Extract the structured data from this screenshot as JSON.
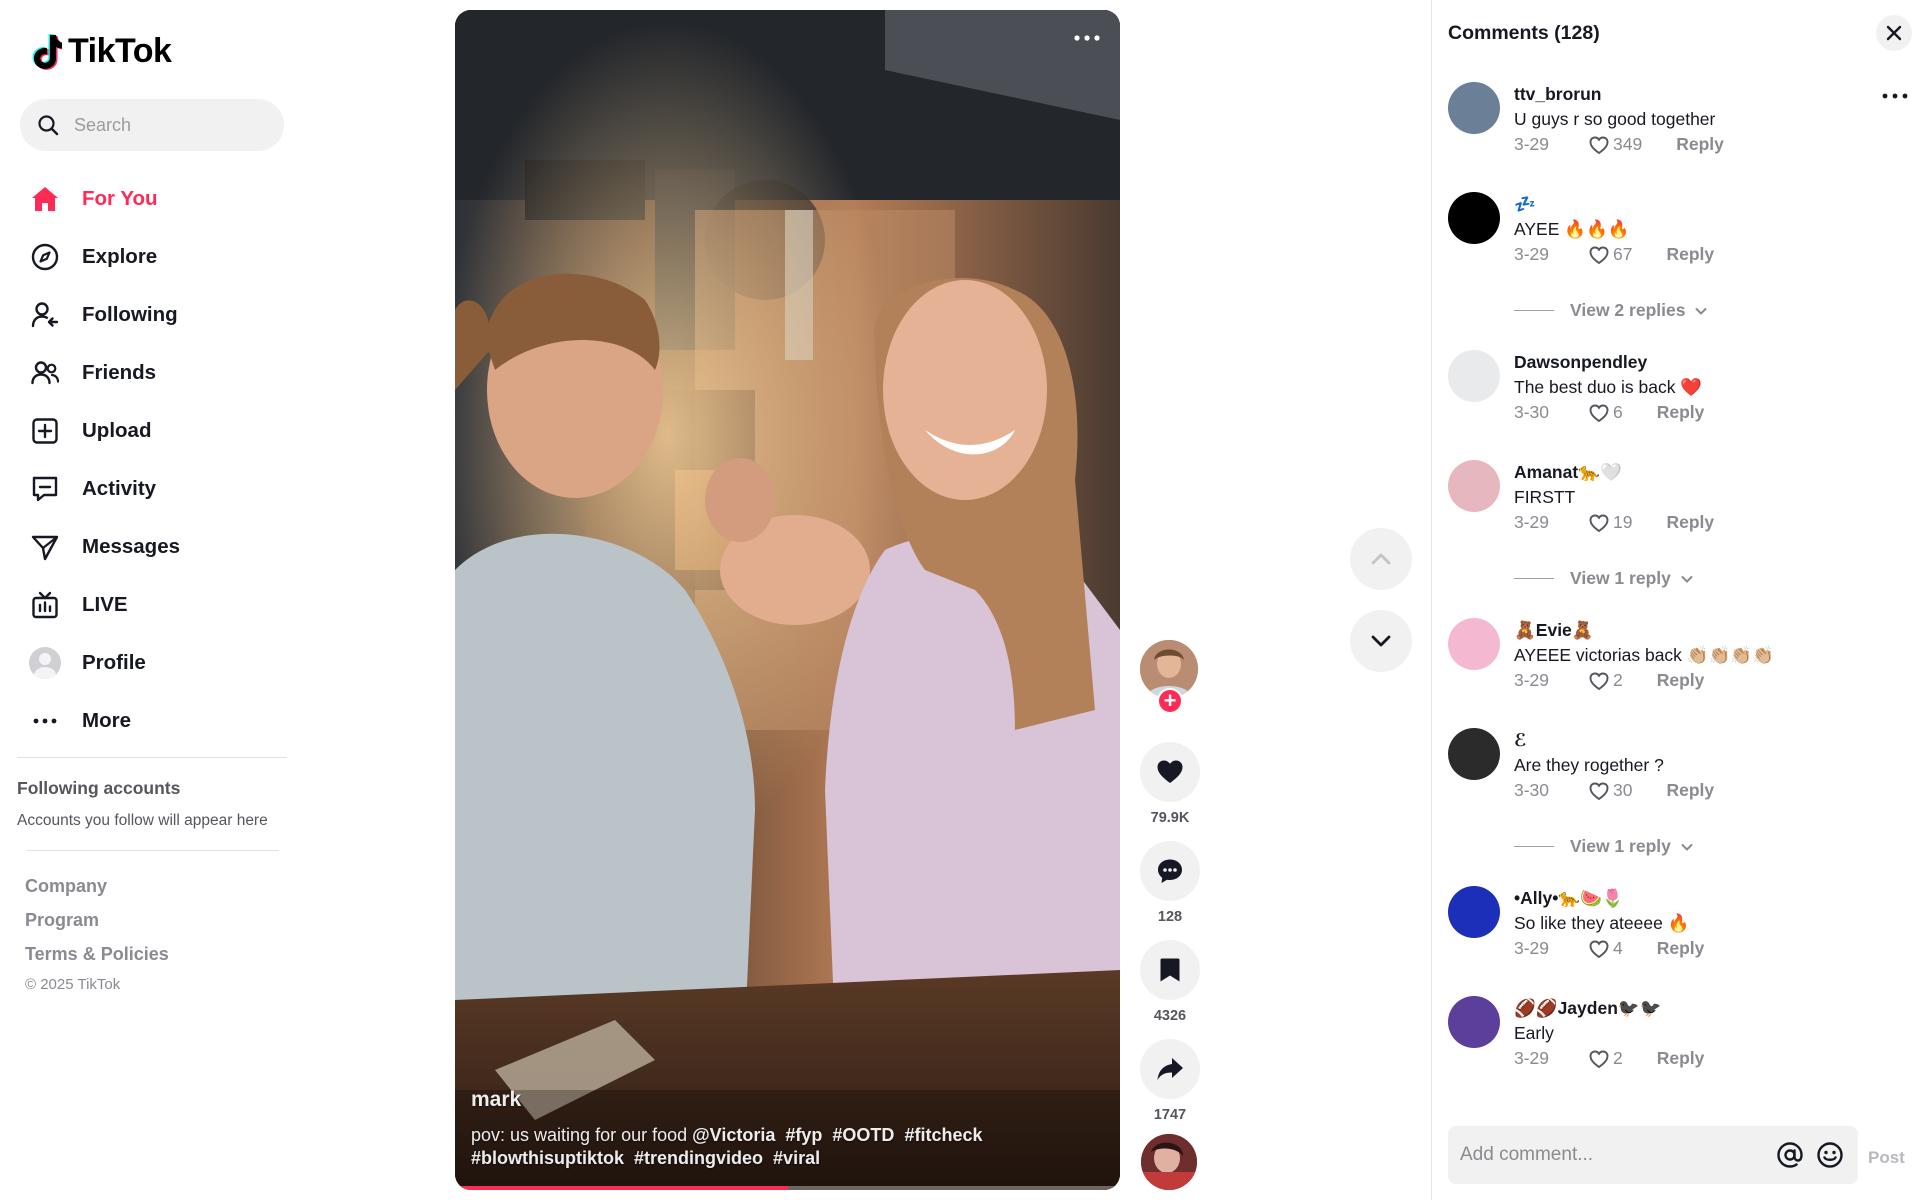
{
  "brand": {
    "name": "TikTok",
    "accent": "#fe2c55"
  },
  "search": {
    "placeholder": "Search"
  },
  "nav": {
    "items": [
      {
        "label": "For You",
        "icon": "home-icon",
        "active": true
      },
      {
        "label": "Explore",
        "icon": "compass-icon"
      },
      {
        "label": "Following",
        "icon": "following-icon"
      },
      {
        "label": "Friends",
        "icon": "friends-icon"
      },
      {
        "label": "Upload",
        "icon": "upload-icon"
      },
      {
        "label": "Activity",
        "icon": "activity-icon"
      },
      {
        "label": "Messages",
        "icon": "messages-icon"
      },
      {
        "label": "LIVE",
        "icon": "live-icon"
      },
      {
        "label": "Profile",
        "icon": "profile-avatar"
      },
      {
        "label": "More",
        "icon": "more-dots-icon"
      }
    ]
  },
  "following_accounts": {
    "title": "Following accounts",
    "subtitle": "Accounts you follow will appear here"
  },
  "footer": {
    "links": [
      "Company",
      "Program",
      "Terms & Policies"
    ],
    "copyright": "© 2025 TikTok"
  },
  "video": {
    "author": "mark",
    "caption_line1_text": "pov: us waiting for our food ",
    "caption_tags_line1": [
      "@Victoria",
      "#fyp",
      "#OOTD",
      "#fitcheck"
    ],
    "caption_tags_line2": [
      "#blowthisuptiktok",
      "#trendingvideo",
      "#viral"
    ],
    "progress_fraction": 0.5
  },
  "actions": {
    "likes": "79.9K",
    "comments": "128",
    "saves": "4326",
    "shares": "1747"
  },
  "comments_panel": {
    "title": "Comments (128)",
    "input_placeholder": "Add comment...",
    "post_label": "Post",
    "reply_label": "Reply",
    "comments": [
      {
        "user": "ttv_brorun",
        "text": "U guys r so good together",
        "date": "3-29",
        "likes": "349",
        "avatar_color": "#6b7f96"
      },
      {
        "user": "💤",
        "text": "AYEE 🔥🔥🔥",
        "date": "3-29",
        "likes": "67",
        "avatar_color": "#000000",
        "view_replies": "View 2 replies"
      },
      {
        "user": "Dawsonpendley",
        "text": "The best duo is back ❤️",
        "date": "3-30",
        "likes": "6",
        "avatar_color": "#e8eaec"
      },
      {
        "user": "Amanat🐆🤍",
        "text": "FIRSTT",
        "date": "3-29",
        "likes": "19",
        "avatar_color": "#e7b7c0",
        "view_replies": "View 1 reply"
      },
      {
        "user": "🧸Evie🧸",
        "text": "AYEEE victorias back 👏🏼👏🏼👏🏼👏🏼",
        "date": "3-29",
        "likes": "2",
        "avatar_color": "#f4b8d0"
      },
      {
        "user": "ℰ",
        "text": "Are they rogether ?",
        "date": "3-30",
        "likes": "30",
        "avatar_color": "#2b2b2b",
        "view_replies": "View 1 reply"
      },
      {
        "user": "•Ally•🐆🍉🌷",
        "text": "So like they ateeee 🔥",
        "date": "3-29",
        "likes": "4",
        "avatar_color": "#1b2fb8"
      },
      {
        "user": "🏈🏈Jayden🐦‍⬛🐦‍⬛",
        "text": "Early",
        "date": "3-29",
        "likes": "2",
        "avatar_color": "#5b3f9a"
      }
    ]
  }
}
